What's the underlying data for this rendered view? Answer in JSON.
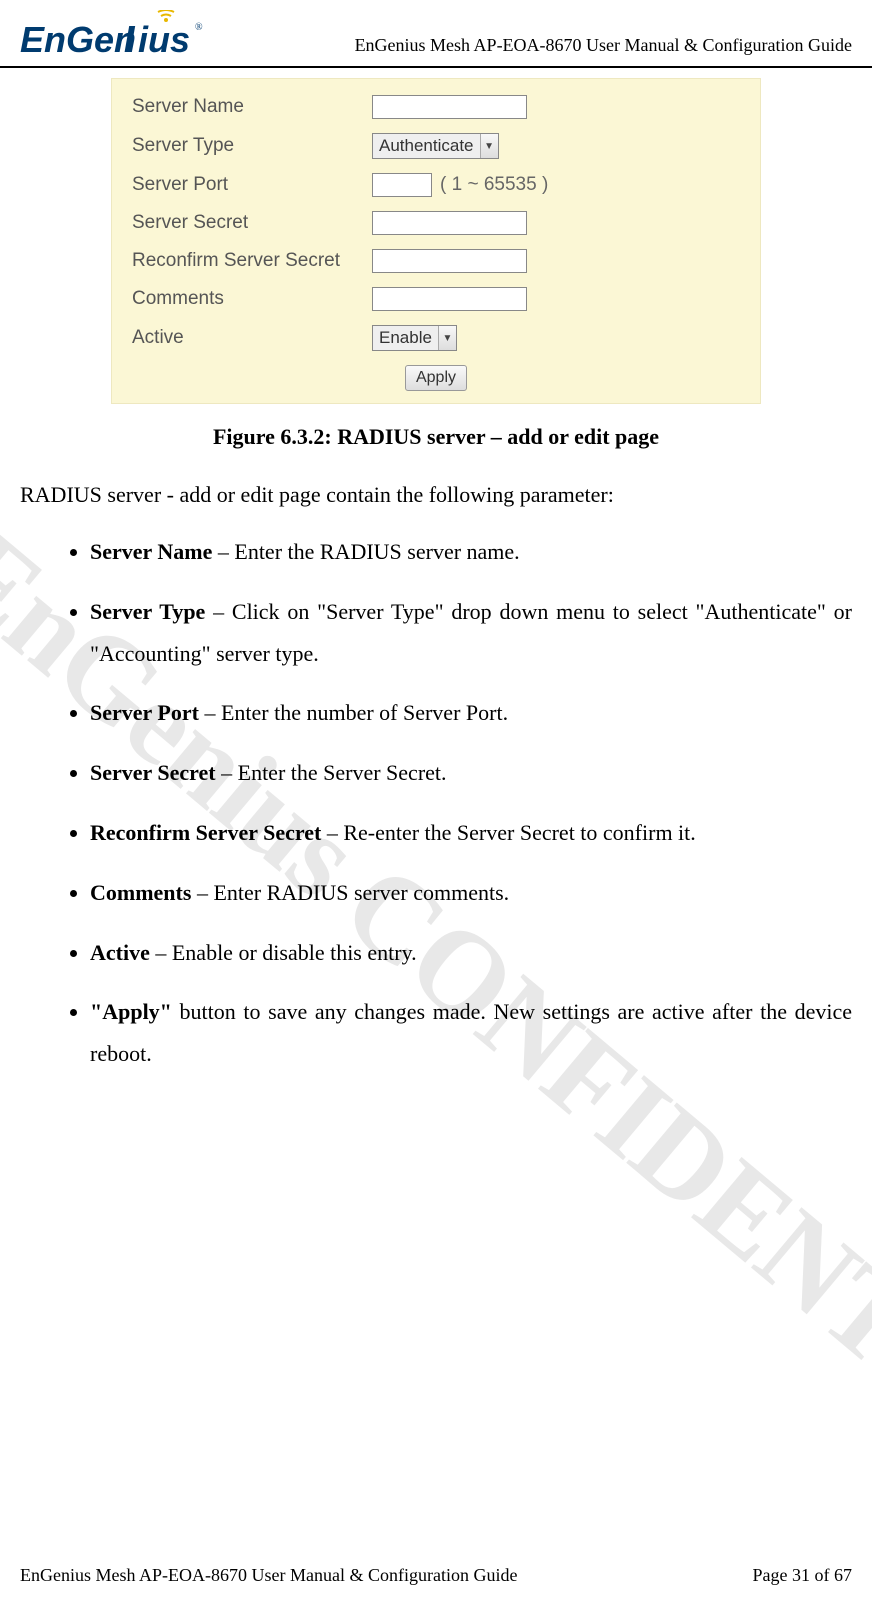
{
  "header": {
    "logo_text": "EnGenius",
    "doc_title": "EnGenius Mesh AP-EOA-8670 User Manual & Configuration Guide"
  },
  "watermark": "EnGenius CONFIDENTIAL",
  "form": {
    "rows": {
      "server_name": {
        "label": "Server Name",
        "value": ""
      },
      "server_type": {
        "label": "Server Type",
        "selected": "Authenticate"
      },
      "server_port": {
        "label": "Server Port",
        "value": "",
        "hint": "( 1 ~ 65535 )"
      },
      "server_secret": {
        "label": "Server Secret",
        "value": ""
      },
      "reconfirm_secret": {
        "label": "Reconfirm Server Secret",
        "value": ""
      },
      "comments": {
        "label": "Comments",
        "value": ""
      },
      "active": {
        "label": "Active",
        "selected": "Enable"
      }
    },
    "apply_label": "Apply"
  },
  "caption": "Figure 6.3.2: RADIUS server – add or edit page",
  "intro": "RADIUS server - add or edit page contain the following parameter:",
  "params": [
    {
      "bold": "Server Name",
      "rest": " – Enter the RADIUS server name."
    },
    {
      "bold": "Server Type",
      "rest": " – Click on \"Server Type\" drop down menu to select \"Authenticate\" or \"Accounting\" server type."
    },
    {
      "bold": "Server Port",
      "rest": " – Enter the number of Server Port."
    },
    {
      "bold": "Server Secret",
      "rest": " – Enter the Server Secret."
    },
    {
      "bold": "Reconfirm Server Secret",
      "rest": " – Re-enter the Server Secret to confirm it."
    },
    {
      "bold": "Comments",
      "rest": " – Enter RADIUS server comments."
    },
    {
      "bold": "Active",
      "rest": " – Enable or disable this entry."
    },
    {
      "bold": "\"Apply\"",
      "rest": " button to save any changes made. New settings are active after the device reboot."
    }
  ],
  "footer": {
    "left": "EnGenius Mesh AP-EOA-8670 User Manual & Configuration Guide",
    "right": "Page 31 of 67"
  }
}
